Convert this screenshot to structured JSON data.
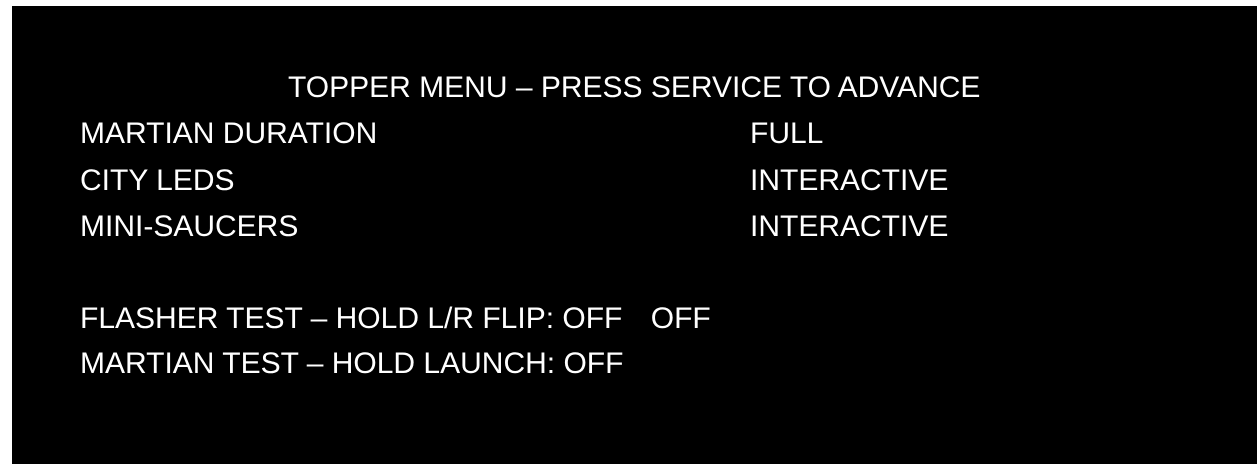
{
  "menu": {
    "title": "TOPPER MENU – PRESS SERVICE TO ADVANCE",
    "settings": [
      {
        "label": "MARTIAN DURATION",
        "value": "FULL"
      },
      {
        "label": "CITY LEDS",
        "value": "INTERACTIVE"
      },
      {
        "label": "MINI-SAUCERS",
        "value": "INTERACTIVE"
      }
    ],
    "tests": {
      "flasher_label": "FLASHER TEST – HOLD L/R FLIP:",
      "flasher_left": "OFF",
      "flasher_right": "OFF",
      "martian_label": "MARTIAN TEST – HOLD LAUNCH:",
      "martian_state": "OFF"
    }
  },
  "colors": {
    "background": "#000000",
    "text": "#ffffff"
  }
}
